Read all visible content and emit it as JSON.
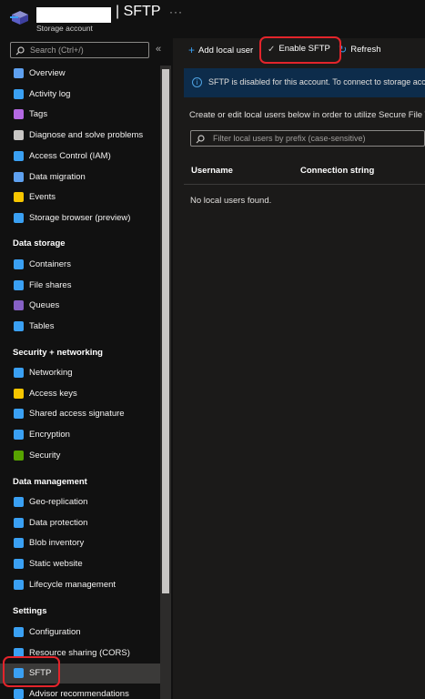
{
  "header": {
    "title": "| SFTP",
    "subtitle": "Storage account",
    "more": "···"
  },
  "sidebar": {
    "search_placeholder": "Search (Ctrl+/)",
    "collapse": "«",
    "items_top": [
      {
        "label": "Overview",
        "icon": "overview-icon",
        "color": "#5ea0ef"
      },
      {
        "label": "Activity log",
        "icon": "activity-log-icon",
        "color": "#3aa0f3"
      },
      {
        "label": "Tags",
        "icon": "tag-icon",
        "color": "#b469e3"
      },
      {
        "label": "Diagnose and solve problems",
        "icon": "wrench-icon",
        "color": "#c8c6c4"
      },
      {
        "label": "Access Control (IAM)",
        "icon": "people-icon",
        "color": "#3aa0f3"
      },
      {
        "label": "Data migration",
        "icon": "data-migration-icon",
        "color": "#5ea0ef"
      },
      {
        "label": "Events",
        "icon": "lightning-icon",
        "color": "#f7c600"
      },
      {
        "label": "Storage browser (preview)",
        "icon": "storage-browser-icon",
        "color": "#3aa0f3"
      }
    ],
    "sections": {
      "data_storage": "Data storage",
      "security": "Security + networking",
      "data_management": "Data management",
      "settings": "Settings"
    },
    "items_storage": [
      {
        "label": "Containers",
        "icon": "containers-icon",
        "color": "#3aa0f3"
      },
      {
        "label": "File shares",
        "icon": "file-shares-icon",
        "color": "#3aa0f3"
      },
      {
        "label": "Queues",
        "icon": "queues-icon",
        "color": "#8661c5"
      },
      {
        "label": "Tables",
        "icon": "tables-icon",
        "color": "#3aa0f3"
      }
    ],
    "items_security": [
      {
        "label": "Networking",
        "icon": "networking-icon",
        "color": "#3aa0f3"
      },
      {
        "label": "Access keys",
        "icon": "key-icon",
        "color": "#f7c600"
      },
      {
        "label": "Shared access signature",
        "icon": "link-icon",
        "color": "#3aa0f3"
      },
      {
        "label": "Encryption",
        "icon": "lock-icon",
        "color": "#3aa0f3"
      },
      {
        "label": "Security",
        "icon": "shield-icon",
        "color": "#57a300"
      }
    ],
    "items_management": [
      {
        "label": "Geo-replication",
        "icon": "globe-icon",
        "color": "#3aa0f3"
      },
      {
        "label": "Data protection",
        "icon": "data-protection-icon",
        "color": "#3aa0f3"
      },
      {
        "label": "Blob inventory",
        "icon": "inventory-icon",
        "color": "#3aa0f3"
      },
      {
        "label": "Static website",
        "icon": "website-icon",
        "color": "#3aa0f3"
      },
      {
        "label": "Lifecycle management",
        "icon": "lifecycle-icon",
        "color": "#3aa0f3"
      }
    ],
    "items_settings": [
      {
        "label": "Configuration",
        "icon": "configuration-icon",
        "color": "#3aa0f3"
      },
      {
        "label": "Resource sharing (CORS)",
        "icon": "cors-icon",
        "color": "#3aa0f3"
      },
      {
        "label": "SFTP",
        "icon": "sftp-icon",
        "color": "#3aa0f3",
        "selected": true
      },
      {
        "label": "Advisor recommendations",
        "icon": "advisor-icon",
        "color": "#3aa0f3"
      }
    ]
  },
  "toolbar": {
    "add_label": "Add local user",
    "enable_label": "Enable SFTP",
    "refresh_label": "Refresh"
  },
  "banner": {
    "text": "SFTP is disabled for this account. To connect to storage account using SFTP, enable it."
  },
  "main": {
    "description": "Create or edit local users below in order to utilize Secure File Transfer Protocol (SFTP) for this account.",
    "filter_placeholder": "Filter local users by prefix (case-sensitive)",
    "columns": [
      "Username",
      "Connection string"
    ],
    "empty_text": "No local users found."
  },
  "colors": {
    "accent": "#3aa0f3",
    "highlight": "#e3242b",
    "banner": "#0d2c4b"
  }
}
